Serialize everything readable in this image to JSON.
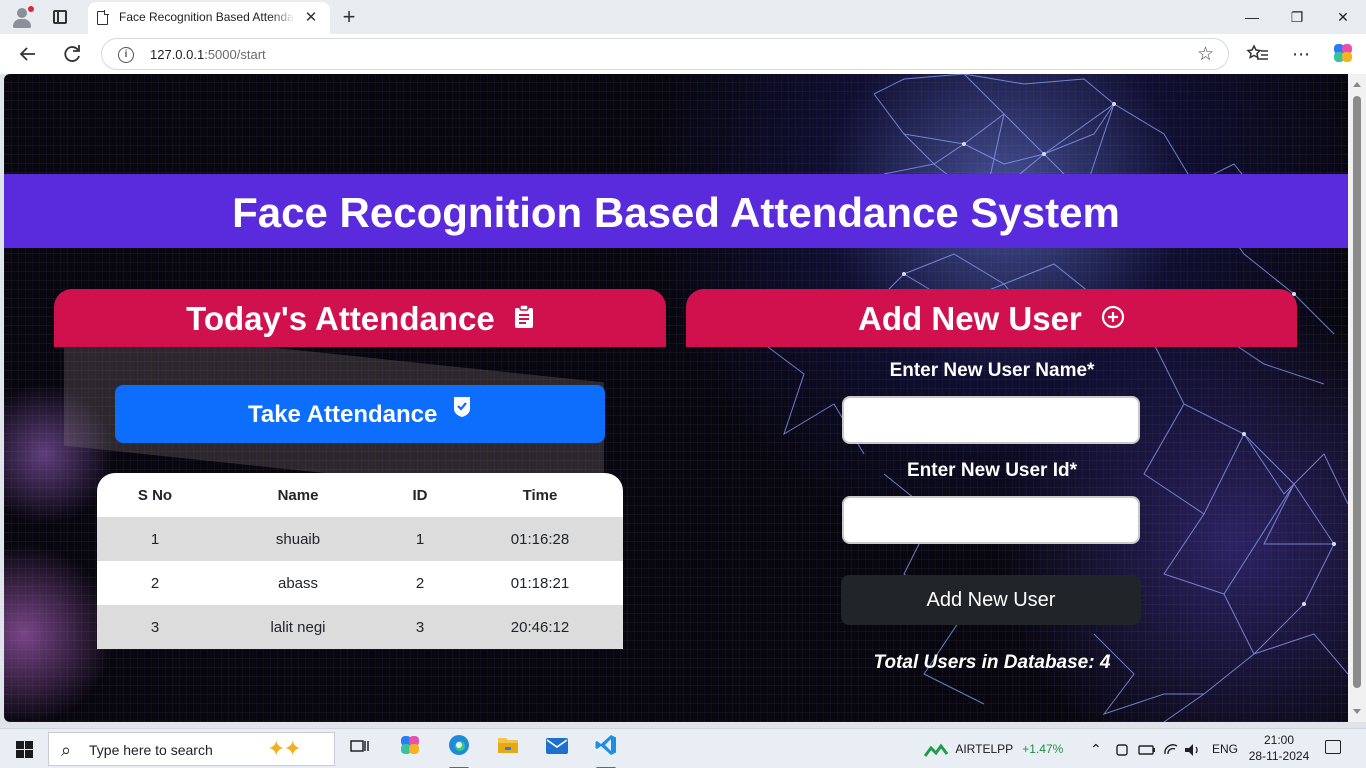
{
  "browser": {
    "tab_title": "Face Recognition Based Attendance System",
    "tab_close": "✕",
    "new_tab": "+",
    "url_host": "127.0.0.1",
    "url_path": ":5000/start",
    "window_controls": {
      "minimize": "—",
      "restore": "❐",
      "close": "✕"
    },
    "icons": [
      "back-icon",
      "refresh-icon",
      "info-icon",
      "star-icon",
      "favorites-icon",
      "more-icon",
      "copilot-icon"
    ]
  },
  "page": {
    "title": "Face Recognition Based Attendance System",
    "attendance_panel": {
      "heading": "Today's Attendance",
      "take_button": "Take Attendance",
      "table": {
        "headers": [
          "S No",
          "Name",
          "ID",
          "Time"
        ],
        "rows": [
          [
            "1",
            "shuaib",
            "1",
            "01:16:28"
          ],
          [
            "2",
            "abass",
            "2",
            "01:18:21"
          ],
          [
            "3",
            "lalit negi",
            "3",
            "20:46:12"
          ]
        ]
      }
    },
    "add_user_panel": {
      "heading": "Add New User",
      "name_label": "Enter New User Name*",
      "name_value": "",
      "id_label": "Enter New User Id*",
      "id_value": "",
      "submit": "Add New User",
      "total_users": "Total Users in Database: 4"
    },
    "colors": {
      "header_band": "#5a2bdc",
      "panel_header": "#d1114e",
      "take_button": "#0d6efd",
      "add_button": "#212529"
    }
  },
  "taskbar": {
    "search_placeholder": "Type here to search",
    "network_name": "AIRTELPP",
    "network_change": "+1.47%",
    "language": "ENG",
    "time": "21:00",
    "date": "28-11-2024",
    "apps": [
      "task-view-icon",
      "copilot-app-icon",
      "edge-icon",
      "file-explorer-icon",
      "mail-icon",
      "vscode-icon"
    ]
  }
}
